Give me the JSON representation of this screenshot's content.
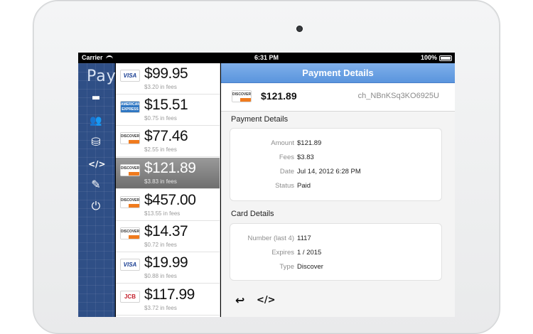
{
  "status": {
    "carrier": "Carrier",
    "time": "6:31 PM",
    "battery": "100%"
  },
  "sidebar": {
    "brand": "Pay",
    "items": [
      {
        "icon": "card-icon",
        "glyph": "▬"
      },
      {
        "icon": "users-icon",
        "glyph": "👥"
      },
      {
        "icon": "coins-icon",
        "glyph": "⛁"
      },
      {
        "icon": "code-icon",
        "glyph": "</>"
      },
      {
        "icon": "edit-icon",
        "glyph": "✎"
      },
      {
        "icon": "power-icon",
        "glyph": "⏻"
      }
    ]
  },
  "charges": [
    {
      "brand": "VISA",
      "amount": "$99.95",
      "fees": "$3.20 in fees"
    },
    {
      "brand": "AMERICAN EXPRESS",
      "amount": "$15.51",
      "fees": "$0.75 in fees"
    },
    {
      "brand": "DISCOVER",
      "amount": "$77.46",
      "fees": "$2.55 in fees"
    },
    {
      "brand": "DISCOVER",
      "amount": "$121.89",
      "fees": "$3.83 in fees"
    },
    {
      "brand": "DISCOVER",
      "amount": "$457.00",
      "fees": "$13.55 in fees"
    },
    {
      "brand": "DISCOVER",
      "amount": "$14.37",
      "fees": "$0.72 in fees"
    },
    {
      "brand": "VISA",
      "amount": "$19.99",
      "fees": "$0.88 in fees"
    },
    {
      "brand": "JCB",
      "amount": "$117.99",
      "fees": "$3.72 in fees"
    }
  ],
  "detail": {
    "title": "Payment Details",
    "brand": "DISCOVER",
    "amount": "$121.89",
    "charge_id": "ch_NBnKSq3KO6925U",
    "payment_section": "Payment Details",
    "payment": [
      {
        "label": "Amount",
        "value": "$121.89"
      },
      {
        "label": "Fees",
        "value": "$3.83"
      },
      {
        "label": "Date",
        "value": "Jul 14, 2012 6:28 PM"
      },
      {
        "label": "Status",
        "value": "Paid"
      }
    ],
    "card_section": "Card Details",
    "card": [
      {
        "label": "Number (last 4)",
        "value": "1117"
      },
      {
        "label": "Expires",
        "value": "1 / 2015"
      },
      {
        "label": "Type",
        "value": "Discover"
      }
    ],
    "toolbar": {
      "reply": "↩",
      "code": "</>"
    }
  }
}
